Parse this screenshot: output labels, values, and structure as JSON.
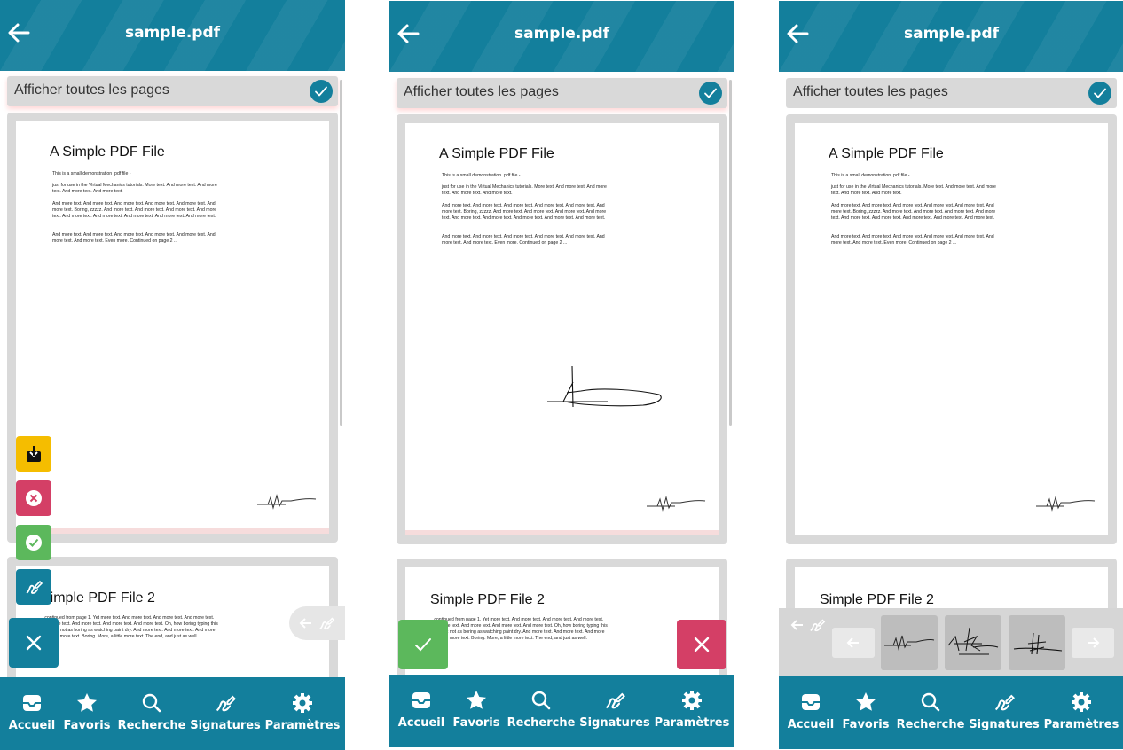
{
  "colors": {
    "primary": "#137f9c",
    "yellow": "#f5bd00",
    "red": "#d43f66",
    "green": "#5cb85c"
  },
  "header": {
    "title": "sample.pdf",
    "back_icon": "arrow-left-icon"
  },
  "toggle": {
    "label": "Afficher toutes les pages",
    "checked": true
  },
  "page1": {
    "title": "A Simple PDF File",
    "paragraphs": [
      "This is a small demonstration .pdf file -",
      "just for use in the Virtual Mechanics tutorials. More text. And more text. And more text. And more text. And more text.",
      "And more text. And more text. And more text. And more text. And more text. And more text. Boring, zzzzz. And more text. And more text. And more text. And more text. And more text. And more text. And more text. And more text. And more text.",
      "And more text. And more text. And more text. And more text. And more text. And more text. And more text. Even more. Continued on page 2 ..."
    ]
  },
  "page2": {
    "title": "Simple PDF File 2",
    "paragraph": "...continued from page 1. Yet more text. And more text. And more text. And more text. And more text. And more text. And more text. And more text. Oh, how boring typing this stuff. But not as boring as watching paint dry. And more text. And more text. And more text. And more text. Boring. More, a little more text. The end, and just as well."
  },
  "tabs": [
    {
      "label": "Accueil",
      "icon": "inbox-icon"
    },
    {
      "label": "Favoris",
      "icon": "star-icon"
    },
    {
      "label": "Recherche",
      "icon": "search-icon"
    },
    {
      "label": "Signatures",
      "icon": "signature-icon"
    },
    {
      "label": "Paramètres",
      "icon": "gear-icon"
    }
  ],
  "actions": {
    "download": "download-icon",
    "reject": "close-circle-icon",
    "approve": "check-circle-icon",
    "sign": "signature-icon",
    "close": "close-icon",
    "confirm": "check-icon",
    "cancel": "close-icon"
  }
}
